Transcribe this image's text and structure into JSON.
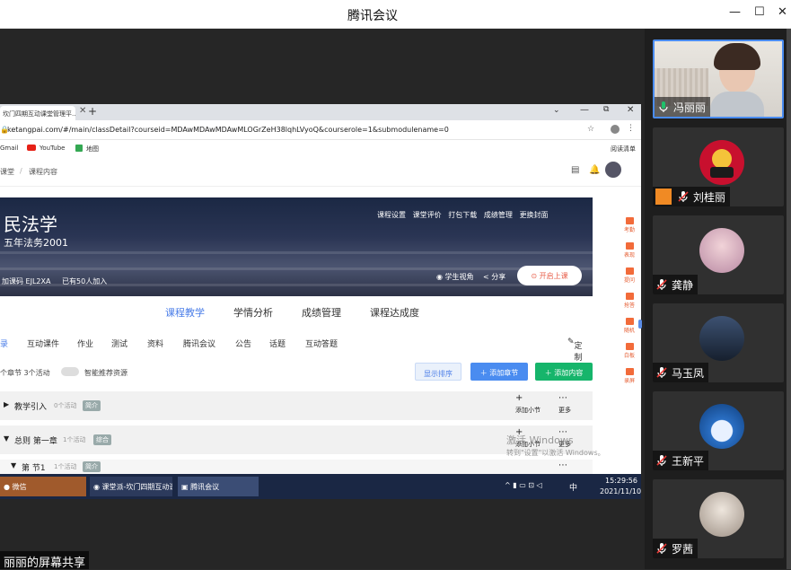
{
  "window": {
    "title": "腾讯会议"
  },
  "browser": {
    "tab_title": "坎门四期互动课堂管理平…",
    "url": "ketangpai.com/#/main/classDetail?courseid=MDAwMDAwMDAwMLOGrZeH38lqhLVyoQ&courserole=1&submodulename=0",
    "bookmarks": [
      "Gmail",
      "YouTube",
      "地图"
    ],
    "bookmarks_right": "阅读清单"
  },
  "page": {
    "breadcrumb_home": "课堂",
    "breadcrumb_current": "课程内容",
    "course_title": "民法学",
    "course_class": "五年法务2001",
    "join_code": "加课码 EJL2XA",
    "joined": "已有50人加入",
    "banner_ops": [
      "课程设置",
      "课堂评价",
      "打包下载",
      "成绩管理",
      "更换封面"
    ],
    "view_label": "学生视角",
    "share_label": "分享",
    "start_button": "开启上课",
    "nav_tabs": [
      "课程教学",
      "学情分析",
      "成绩管理",
      "课程达成度"
    ],
    "sub_tabs": [
      "录",
      "互动课件",
      "作业",
      "测试",
      "资料",
      "腾讯会议",
      "公告",
      "话题",
      "互动答题"
    ],
    "customize": "定制",
    "counts": "个章节  3个活动",
    "recommend_toggle": "智能推荐资源",
    "btn_show_order": "显示排序",
    "btn_add_chapter": "添加章节",
    "btn_add_content": "添加内容",
    "sections": [
      {
        "name": "教学引入",
        "count": "0个活动",
        "tag": "简介",
        "action1": "添加小节",
        "action2": "更多"
      },
      {
        "name": "总则 第一章",
        "count": "1个活动",
        "tag": "综合",
        "action1": "添加小节",
        "action2": "更多"
      },
      {
        "name": "第   节1",
        "count": "1个活动",
        "tag": "简介",
        "action2": "更多"
      }
    ],
    "right_sidebar": [
      "考勤",
      "表现",
      "提问",
      "抢答",
      "随机",
      "白板",
      "录屏"
    ]
  },
  "taskbar": {
    "items": [
      "微信",
      "课堂派-坎门四期互动课…",
      "腾讯会议"
    ],
    "time": "15:29:56",
    "date": "2021/11/10",
    "ime": "中"
  },
  "watermark": {
    "line1": "激活 Windows",
    "line2": "转到\"设置\"以激活 Windows。"
  },
  "share_label": "丽丽的屏幕共享",
  "participants": [
    {
      "name": "冯丽丽",
      "type": "video",
      "mic": "on"
    },
    {
      "name": "刘桂丽",
      "type": "avatar",
      "mic": "muted",
      "color": "#c8102e"
    },
    {
      "name": "龚静",
      "type": "avatar",
      "mic": "muted",
      "color": "#d9b7c9"
    },
    {
      "name": "马玉凤",
      "type": "avatar",
      "mic": "muted",
      "color": "#25334d"
    },
    {
      "name": "王新平",
      "type": "avatar",
      "mic": "muted",
      "color": "#1d5fa8"
    },
    {
      "name": "罗茜",
      "type": "avatar",
      "mic": "muted",
      "color": "#c6bfb7"
    }
  ],
  "colors": {
    "accent": "#4a8cf0",
    "brand_orange": "#e8604c",
    "green": "#16b56b"
  }
}
